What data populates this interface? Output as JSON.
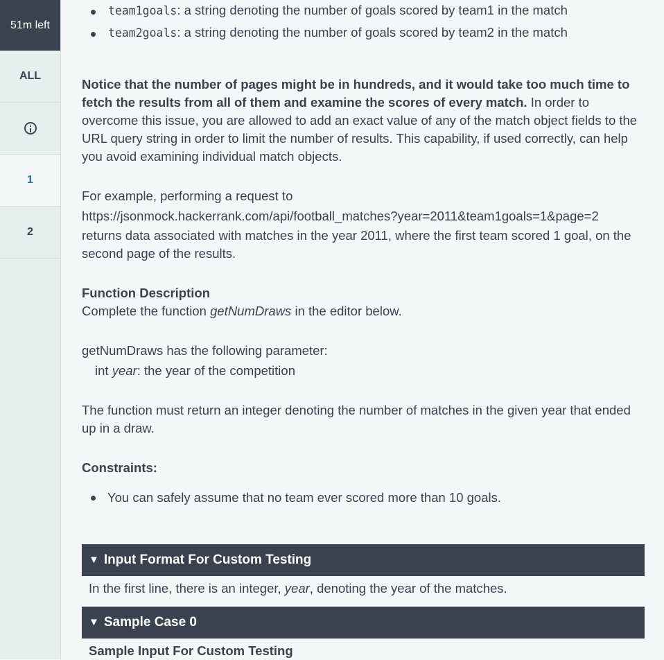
{
  "sidebar": {
    "timer": "51m left",
    "items": [
      {
        "label": "ALL"
      },
      {
        "label": "",
        "icon": "info-icon"
      },
      {
        "label": "1"
      },
      {
        "label": "2"
      }
    ]
  },
  "fields": [
    {
      "name": "team1goals",
      "desc": ": a string denoting the number of goals scored by team1 in the match"
    },
    {
      "name": "team2goals",
      "desc": ": a string denoting the number of goals scored by team2 in the match"
    }
  ],
  "notice": {
    "bold": "Notice that the number of pages might be in hundreds, and it would take too much time to fetch the results from all of them and examine the scores of every match.",
    "rest": " In order to overcome this issue, you are allowed to add an exact value of any of the match object fields to the URL query string in order to limit the number of results. This capability, if used correctly, can help you avoid examining individual match objects."
  },
  "example": {
    "intro": "For example, performing a request to",
    "url": "https://jsonmock.hackerrank.com/api/football_matches?year=2011&team1goals=1&page=2",
    "rest": "returns data associated with matches in the year 2011, where the first team scored 1 goal, on the second page of the results."
  },
  "function_desc": {
    "heading": "Function Description",
    "pre": "Complete the function ",
    "fn": "getNumDraws",
    "post": " in the editor below."
  },
  "params": {
    "intro": "getNumDraws has the following parameter:",
    "type": "int ",
    "name": "year",
    "desc": ": the year of the competition"
  },
  "returns": "The function must return an integer denoting the number of matches in the given year that ended up in a draw.",
  "constraints": {
    "heading": "Constraints:",
    "items": [
      "You can safely assume that no team ever scored more than 10 goals."
    ]
  },
  "input_format": {
    "title": "Input Format For Custom Testing",
    "pre": "In the first line, there is an integer, ",
    "var": "year",
    "post": ", denoting the year of the matches."
  },
  "sample_case": {
    "title": "Sample Case 0",
    "subheading": "Sample Input For Custom Testing"
  },
  "colors": {
    "dark": "#39424e",
    "background": "#f3f7f7",
    "sidebar": "#e6eeee",
    "active": "#1d6fa5"
  }
}
